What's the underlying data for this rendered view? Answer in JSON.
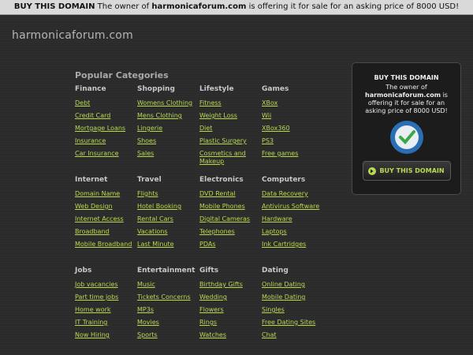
{
  "topbar": {
    "buy_label": "BUY THIS DOMAIN",
    "pre": "The owner of",
    "domain": "harmonicaforum.com",
    "post": "is offering it for sale for an asking price of 8000 USD!"
  },
  "site_title": "harmonicaforum.com",
  "popular_heading": "Popular Categories",
  "categories": [
    {
      "heading": "Finance",
      "links": [
        "Debt",
        "Credit Card",
        "Mortgage Loans",
        "Insurance",
        "Car Insurance"
      ]
    },
    {
      "heading": "Shopping",
      "links": [
        "Womens Clothing",
        "Mens Clothing",
        "Lingerie",
        "Shoes",
        "Sales"
      ]
    },
    {
      "heading": "Lifestyle",
      "links": [
        "Fitness",
        "Weight Loss",
        "Diet",
        "Plastic Surgery",
        "Cosmetics and Makeup"
      ]
    },
    {
      "heading": "Games",
      "links": [
        "XBox",
        "Wii",
        "XBox360",
        "PS3",
        "Free games"
      ]
    },
    {
      "heading": "Internet",
      "links": [
        "Domain Name",
        "Web Design",
        "Internet Access",
        "Broadband",
        "Mobile Broadband"
      ]
    },
    {
      "heading": "Travel",
      "links": [
        "Flights",
        "Hotel Booking",
        "Rental Cars",
        "Vacations",
        "Last Minute"
      ]
    },
    {
      "heading": "Electronics",
      "links": [
        "DVD Rental",
        "Mobile Phones",
        "Digital Cameras",
        "Telephones",
        "PDAs"
      ]
    },
    {
      "heading": "Computers",
      "links": [
        "Data Recovery",
        "Antivirus Software",
        "Hardware",
        "Laptops",
        "Ink Cartridges"
      ]
    },
    {
      "heading": "Jobs",
      "links": [
        "Job vacancies",
        "Part time jobs",
        "Home work",
        "IT Training",
        "Now Hiring"
      ]
    },
    {
      "heading": "Entertainment",
      "links": [
        "Music",
        "Tickets Concerns",
        "MP3s",
        "Movies",
        "Sports"
      ]
    },
    {
      "heading": "Gifts",
      "links": [
        "Birthday Gifts",
        "Wedding",
        "Flowers",
        "Rings",
        "Watches"
      ]
    },
    {
      "heading": "Dating",
      "links": [
        "Online Dating",
        "Mobile Dating",
        "Singles",
        "Free Dating Sites",
        "Chat"
      ]
    }
  ],
  "buy_box": {
    "title": "BUY THIS DOMAIN",
    "pre": "The owner of",
    "domain": "harmonicaforum.com",
    "post": "is offering it for sale for an asking price of 8000 USD!",
    "seal_icon": "safe-buyer-seal-icon",
    "button_label": "BUY THIS DOMAIN",
    "accent": "#b9d94f"
  }
}
